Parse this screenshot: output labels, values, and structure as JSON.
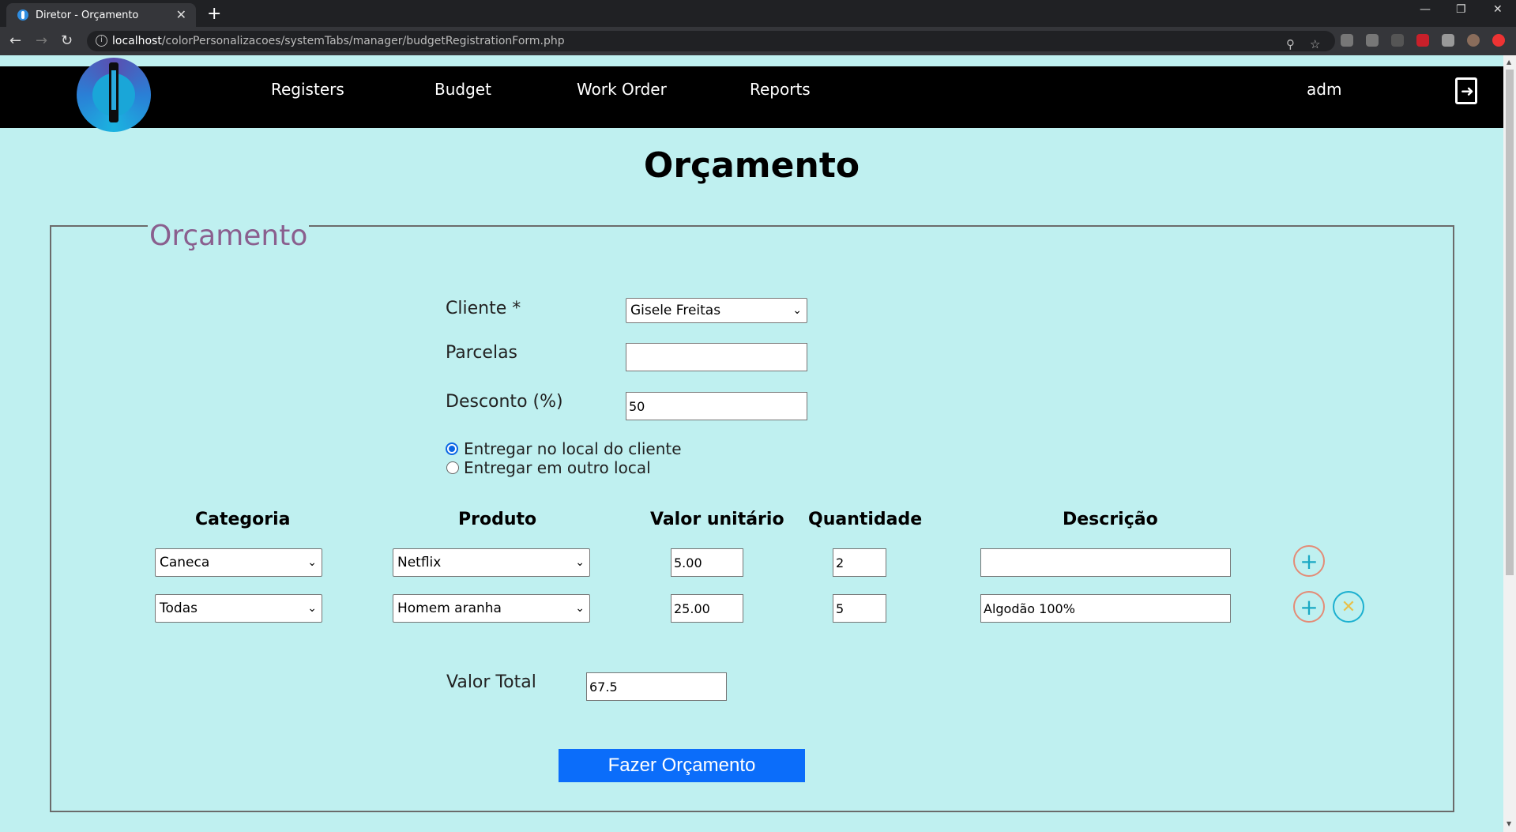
{
  "browser": {
    "tab_title": "Diretor - Orçamento",
    "tab_close": "✕",
    "new_tab": "+",
    "url_host": "localhost",
    "url_path": "/colorPersonalizacoes/systemTabs/manager/budgetRegistrationForm.php",
    "window_controls": [
      "—",
      "❐",
      "✕"
    ]
  },
  "navbar": {
    "links": [
      "Registers",
      "Budget",
      "Work Order",
      "Reports"
    ],
    "user": "adm"
  },
  "page": {
    "title": "Orçamento",
    "legend": "Orçamento"
  },
  "form": {
    "cliente_label": "Cliente *",
    "cliente_value": "Gisele Freitas",
    "parcelas_label": "Parcelas",
    "parcelas_value": "",
    "desconto_label": "Desconto (%)",
    "desconto_value": "50",
    "delivery_options": [
      {
        "label": "Entregar no local do cliente",
        "checked": true
      },
      {
        "label": "Entregar em outro local",
        "checked": false
      }
    ],
    "columns": [
      "Categoria",
      "Produto",
      "Valor unitário",
      "Quantidade",
      "Descrição"
    ],
    "rows": [
      {
        "categoria": "Caneca",
        "produto": "Netflix",
        "valor": "5.00",
        "quantidade": "2",
        "descricao": ""
      },
      {
        "categoria": "Todas",
        "produto": "Homem aranha",
        "valor": "25.00",
        "quantidade": "5",
        "descricao": "Algodão 100%"
      }
    ],
    "valor_total_label": "Valor Total",
    "valor_total_value": "67.5",
    "submit_label": "Fazer Orçamento"
  },
  "icons": {
    "plus": "+",
    "remove": "✕",
    "chevron": "⌄"
  }
}
